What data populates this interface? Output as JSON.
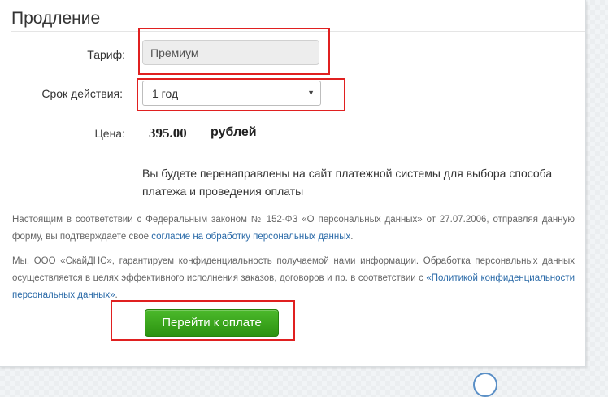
{
  "form": {
    "title": "Продление",
    "tariff": {
      "label": "Тариф:",
      "value": "Премиум"
    },
    "period": {
      "label": "Срок действия:",
      "selected": "1 год"
    },
    "price": {
      "label": "Цена:",
      "value": "395.00",
      "unit": "рублей"
    },
    "redirect_note": "Вы будете перенаправлены на сайт платежной системы для выбора способа платежа и проведения оплаты"
  },
  "legal": {
    "p1_text": "Настоящим в соответствии с Федеральным законом № 152-ФЗ «О персональных данных» от 27.07.2006, отправляя данную форму, вы подтверждаете свое ",
    "p1_link": "согласие на обработку персональных данных",
    "p1_end": ".",
    "p2_text": "Мы, ООО «СкайДНС», гарантируем конфиденциальность получаемой нами информации. Обработка персональных данных осуществляется в целях эффективного исполнения заказов, договоров и пр. в соответствии с ",
    "p2_link": "«Политикой конфиденциальности персональных данных»",
    "p2_end": "."
  },
  "actions": {
    "pay_button": "Перейти к оплате"
  },
  "colors": {
    "highlight": "#e02020",
    "button_green": "#2c9310",
    "link_blue": "#2a6aa8"
  }
}
